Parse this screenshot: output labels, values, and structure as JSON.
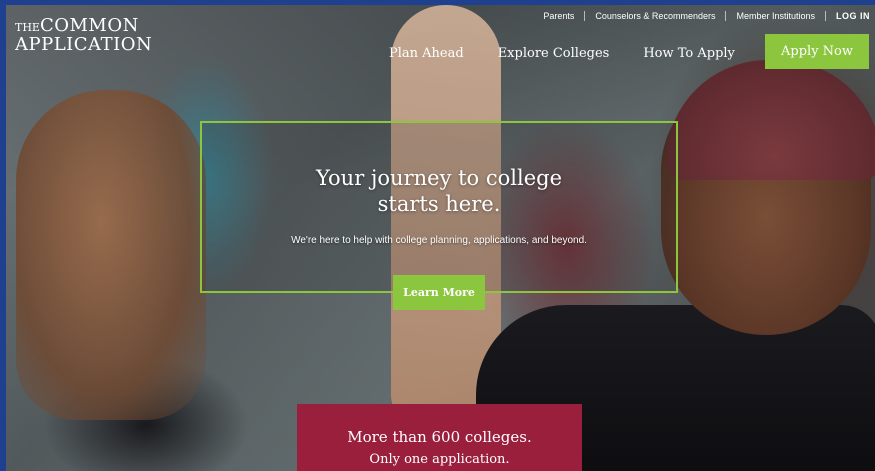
{
  "brand": {
    "logo_line1": "THE COMMON",
    "logo_line2": "APPLICATION",
    "accent_green": "#8cc63f",
    "promo_maroon": "#9a1f3d",
    "frame_blue": "#1f3f8f"
  },
  "utility_nav": {
    "items": [
      "Parents",
      "Counselors & Recommenders",
      "Member Institutions"
    ],
    "login": "LOG IN"
  },
  "main_nav": {
    "items": [
      "Plan Ahead",
      "Explore Colleges",
      "How To Apply"
    ],
    "apply_button": "Apply Now"
  },
  "hero": {
    "headline_line1": "Your journey to college",
    "headline_line2": "starts here.",
    "subheadline": "We're here to help with college planning, applications, and beyond.",
    "cta_button": "Learn More"
  },
  "promo": {
    "line1": "More than 600 colleges.",
    "line2": "Only one application."
  }
}
